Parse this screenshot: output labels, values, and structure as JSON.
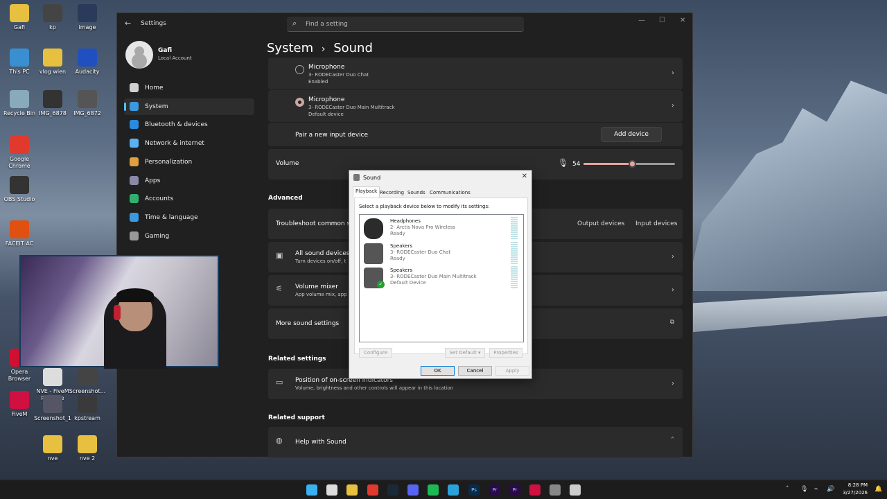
{
  "desktop": {
    "icons": [
      {
        "label": "Gafi",
        "icon": "folder-icon",
        "color": "#e8c040"
      },
      {
        "label": "kp",
        "icon": "file-icon",
        "color": "#444"
      },
      {
        "label": "image",
        "icon": "image-file-icon",
        "color": "#2a3a5a"
      },
      {
        "label": "This PC",
        "icon": "monitor-icon",
        "color": "#3a8fd0"
      },
      {
        "label": "vlog wien",
        "icon": "folder-icon",
        "color": "#e8c040"
      },
      {
        "label": "Audacity",
        "icon": "audacity-icon",
        "color": "#2050c0"
      },
      {
        "label": "Recycle Bin",
        "icon": "recycle-bin-icon",
        "color": "#8ab"
      },
      {
        "label": "IMG_6878",
        "icon": "image-file-icon",
        "color": "#333"
      },
      {
        "label": "IMG_6872",
        "icon": "image-file-icon",
        "color": "#555"
      },
      {
        "label": "Google Chrome",
        "icon": "chrome-icon",
        "color": "#e03a2e"
      },
      {
        "label": "OBS Studio",
        "icon": "obs-icon",
        "color": "#333"
      },
      {
        "label": "FACEIT AC",
        "icon": "faceit-icon",
        "color": "#e05010"
      },
      {
        "label": "Opera Browser",
        "icon": "opera-icon",
        "color": "#d01030"
      },
      {
        "label": "NVE - FiveM Package",
        "icon": "file-icon",
        "color": "#ddd"
      },
      {
        "label": "Screenshot...",
        "icon": "image-file-icon",
        "color": "#444"
      },
      {
        "label": "FiveM",
        "icon": "fivem-icon",
        "color": "#d01040"
      },
      {
        "label": "Screenshot_1",
        "icon": "image-file-icon",
        "color": "#556"
      },
      {
        "label": "kpstream",
        "icon": "file-icon",
        "color": "#3a3a3a"
      },
      {
        "label": "nve",
        "icon": "folder-icon",
        "color": "#e8c040"
      },
      {
        "label": "nve 2",
        "icon": "folder-icon",
        "color": "#e8c040"
      }
    ]
  },
  "settings": {
    "app_title": "Settings",
    "search_placeholder": "Find a setting",
    "profile": {
      "name": "Gafi",
      "account": "Local Account"
    },
    "nav": [
      {
        "label": "Home",
        "icon": "home-icon",
        "color": "#d0d0d0"
      },
      {
        "label": "System",
        "icon": "system-icon",
        "color": "#3a9ae0"
      },
      {
        "label": "Bluetooth & devices",
        "icon": "bluetooth-icon",
        "color": "#2a8ae0"
      },
      {
        "label": "Network & internet",
        "icon": "wifi-icon",
        "color": "#5ab0f0"
      },
      {
        "label": "Personalization",
        "icon": "brush-icon",
        "color": "#e0a040"
      },
      {
        "label": "Apps",
        "icon": "apps-icon",
        "color": "#8a8aa8"
      },
      {
        "label": "Accounts",
        "icon": "accounts-icon",
        "color": "#30b070"
      },
      {
        "label": "Time & language",
        "icon": "globe-clock-icon",
        "color": "#3a9ae0"
      },
      {
        "label": "Gaming",
        "icon": "gaming-icon",
        "color": "#999"
      }
    ],
    "breadcrumb": {
      "parent": "System",
      "sep": "›",
      "current": "Sound"
    },
    "inputs": [
      {
        "title": "Microphone",
        "device": "3- RODECaster Duo Chat",
        "status": "Enabled",
        "selected": false
      },
      {
        "title": "Microphone",
        "device": "3- RODECaster Duo Main Multitrack",
        "status": "Default device",
        "selected": true
      }
    ],
    "pair": {
      "label": "Pair a new input device",
      "button": "Add device"
    },
    "volume": {
      "label": "Volume",
      "value": "54",
      "level": 54
    },
    "advanced": {
      "heading": "Advanced",
      "troubleshoot": "Troubleshoot common so",
      "output_btn": "Output devices",
      "input_btn": "Input devices",
      "all_devices": {
        "title": "All sound devices",
        "sub": "Turn devices on/off, t"
      },
      "mixer": {
        "title": "Volume mixer",
        "sub": "App volume mix, app"
      },
      "more": "More sound settings"
    },
    "related_settings": {
      "heading": "Related settings",
      "osd": {
        "title": "Position of on-screen indicators",
        "sub": "Volume, brightness and other controls will appear in this location"
      }
    },
    "related_support": {
      "heading": "Related support",
      "help": "Help with Sound"
    }
  },
  "dialog": {
    "title": "Sound",
    "tabs": [
      "Playback",
      "Recording",
      "Sounds",
      "Communications"
    ],
    "instruction": "Select a playback device below to modify its settings:",
    "devices": [
      {
        "name": "Headphones",
        "desc": "2- Arctis Nova Pro Wireless",
        "status": "Ready",
        "icon": "headphones-icon",
        "default": false
      },
      {
        "name": "Speakers",
        "desc": "3- RODECaster Duo Chat",
        "status": "Ready",
        "icon": "speaker-icon",
        "default": false
      },
      {
        "name": "Speakers",
        "desc": "3- RODECaster Duo Main Multitrack",
        "status": "Default Device",
        "icon": "speaker-icon",
        "default": true
      }
    ],
    "configure": "Configure",
    "set_default": "Set Default",
    "properties": "Properties",
    "ok": "OK",
    "cancel": "Cancel",
    "apply": "Apply"
  },
  "taskbar": {
    "time": "8:28 PM",
    "date": "3/27/2026",
    "apps": [
      {
        "icon": "windows-start-icon",
        "color": "#3ab0f0"
      },
      {
        "icon": "search-icon",
        "color": "#ddd"
      },
      {
        "icon": "file-explorer-icon",
        "color": "#e8c040"
      },
      {
        "icon": "chrome-icon",
        "color": "#e03a2e"
      },
      {
        "icon": "steam-icon",
        "color": "#1b2838"
      },
      {
        "icon": "discord-icon",
        "color": "#5865f2"
      },
      {
        "icon": "spotify-icon",
        "color": "#1db954"
      },
      {
        "icon": "telegram-icon",
        "color": "#2aa1da"
      },
      {
        "icon": "photoshop-icon",
        "color": "#0a2a4a"
      },
      {
        "icon": "premiere-icon",
        "color": "#2a0a4a"
      },
      {
        "icon": "premiere-icon",
        "color": "#2a0a4a"
      },
      {
        "icon": "fivem-icon",
        "color": "#d01040"
      },
      {
        "icon": "settings-icon",
        "color": "#888"
      },
      {
        "icon": "sound-app-icon",
        "color": "#ccc"
      }
    ],
    "app_labels": {
      "photoshop": "Ps",
      "premiere": "Pr"
    }
  }
}
